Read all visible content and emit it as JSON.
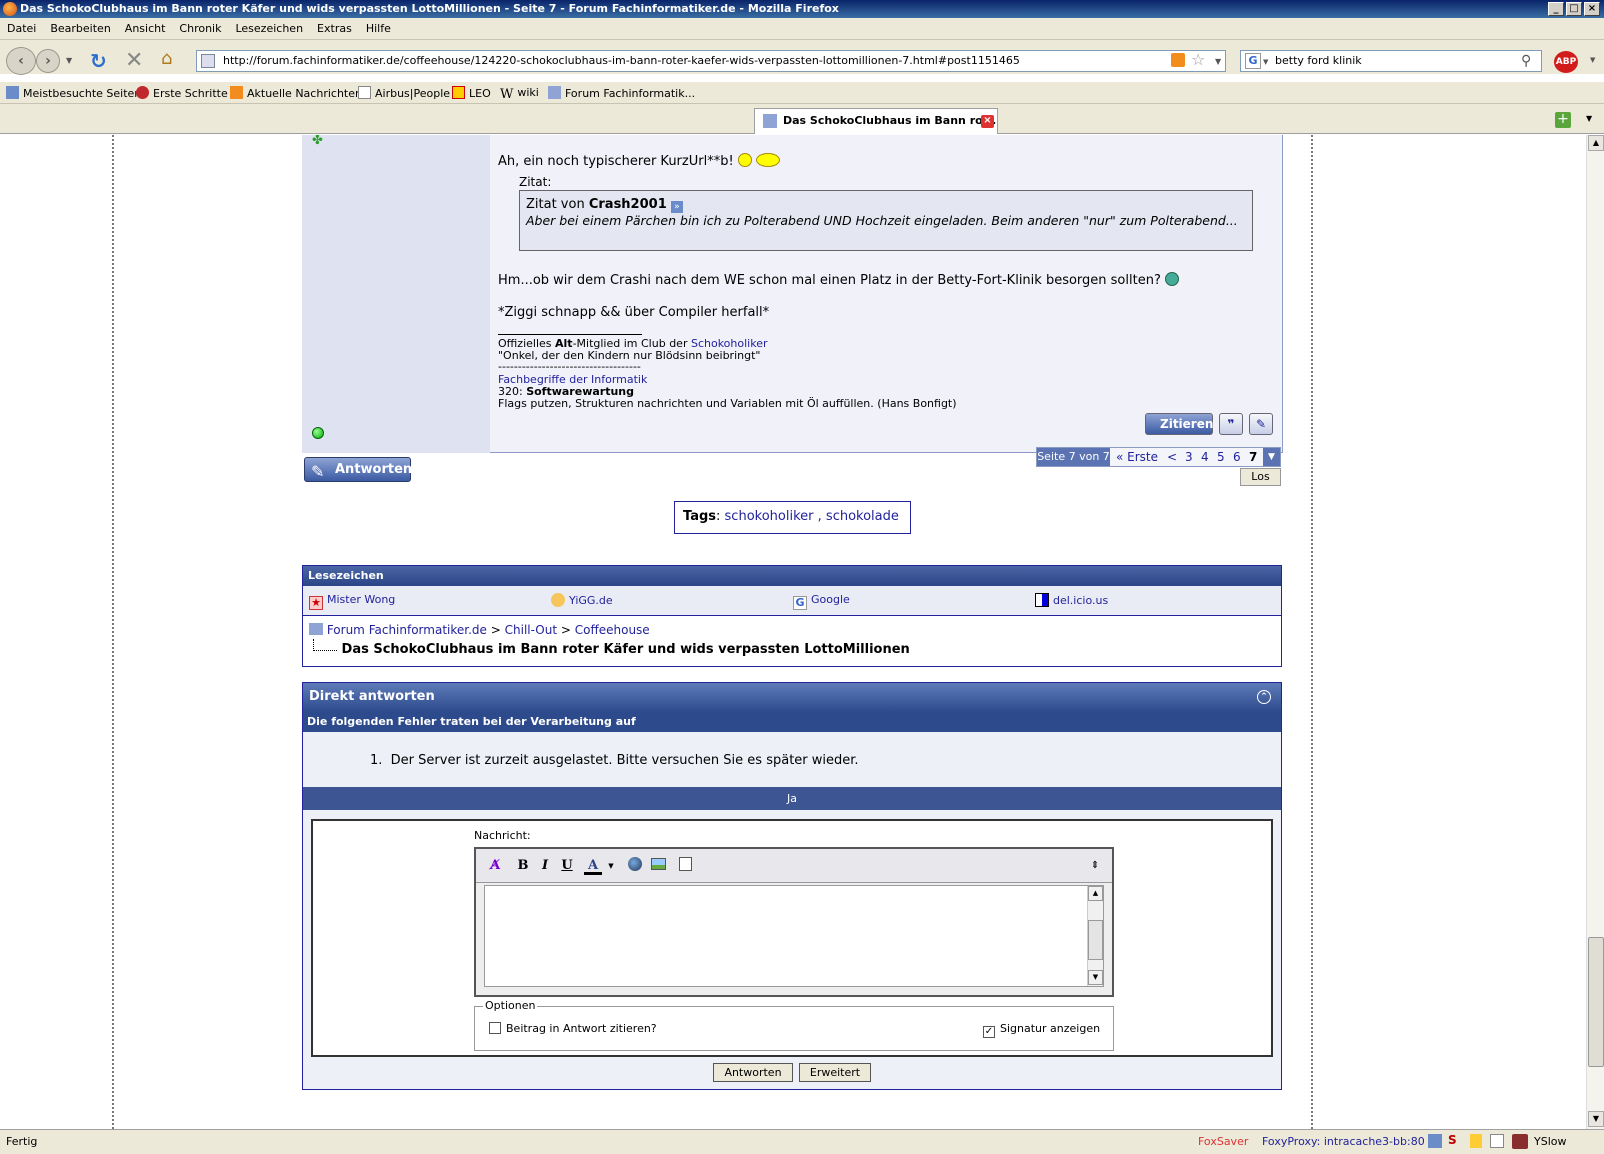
{
  "window": {
    "title": "Das SchokoClubhaus im Bann roter Käfer und wids verpassten LottoMillionen - Seite 7 - Forum Fachinformatiker.de - Mozilla Firefox"
  },
  "menu": [
    "Datei",
    "Bearbeiten",
    "Ansicht",
    "Chronik",
    "Lesezeichen",
    "Extras",
    "Hilfe"
  ],
  "nav": {
    "url": "http://forum.fachinformatiker.de/coffeehouse/124220-schokoclubhaus-im-bann-roter-kaefer-wids-verpassten-lottomillionen-7.html#post1151465",
    "search_value": "betty ford klinik"
  },
  "bookmarks": [
    "Meistbesuchte Seiten",
    "Erste Schritte",
    "Aktuelle Nachrichten",
    "Airbus|People",
    "LEO",
    "wiki",
    "Forum Fachinformatik..."
  ],
  "tab": {
    "label": "Das SchokoClubhaus im Bann rot..."
  },
  "post": {
    "line1": "Ah, ein noch typischerer KurzUrl**b!",
    "quote_label": "Zitat:",
    "quote_by_prefix": "Zitat von",
    "quote_author": "Crash2001",
    "quote_text": "Aber bei einem Pärchen bin ich zu Polterabend UND Hochzeit eingeladen. Beim anderen \"nur\" zum Polterabend...",
    "line2": "Hm...ob wir dem Crashi nach dem WE schon mal einen Platz in der Betty-Fort-Klinik besorgen sollten?",
    "line3": "*Ziggi schnapp && über Compiler herfall*",
    "sig_1_prefix": "Offizielles",
    "sig_1_bold": "Alt",
    "sig_1_mid": "-Mitglied im Club der",
    "sig_1_link": "Schokoholiker",
    "sig_2": "\"Onkel, der den Kindern nur Blödsinn beibringt\"",
    "sig_3": "------------------------------------",
    "sig_4": "Fachbegriffe der Informatik",
    "sig_5_prefix": "320:",
    "sig_5_bold": "Softwarewartung",
    "sig_6": "Flags putzen, Strukturen nachrichten und Variablen mit Öl auffüllen. (Hans Bonfigt)",
    "zitieren_label": "Zitieren"
  },
  "reply_button": "Antworten",
  "pagenav": {
    "label": "Seite 7 von 7",
    "first": "« Erste",
    "prev": "<",
    "pages": [
      "3",
      "4",
      "5",
      "6"
    ],
    "current": "7",
    "go": "Los"
  },
  "tags": {
    "label": "Tags",
    "items": [
      "schokoholiker",
      "schokolade"
    ],
    "separator": ","
  },
  "lesezeichen": {
    "title": "Lesezeichen",
    "items": [
      "Mister Wong",
      "YiGG.de",
      "Google",
      "del.icio.us"
    ]
  },
  "breadcrumb": {
    "items": [
      "Forum Fachinformatiker.de",
      "Chill-Out",
      "Coffeehouse"
    ],
    "separator": ">",
    "current": "Das SchokoClubhaus im Bann roter Käfer und wids verpassten LottoMillionen"
  },
  "direkt": {
    "title": "Direkt antworten",
    "error_header": "Die folgenden Fehler traten bei der Verarbeitung auf",
    "error_num": "1.",
    "error_text": "Der Server ist zurzeit ausgelastet. Bitte versuchen Sie es später wieder.",
    "ja": "Ja",
    "nachricht_label": "Nachricht:",
    "options_legend": "Optionen",
    "opt_quote": "Beitrag in Antwort zitieren?",
    "opt_sig": "Signatur anzeigen",
    "submit": "Antworten",
    "advanced": "Erweitert"
  },
  "status": {
    "left": "Fertig",
    "foxsaver": "FoxSaver",
    "foxyproxy": "FoxyProxy: intracache3-bb:80",
    "yslow": "YSlow"
  }
}
